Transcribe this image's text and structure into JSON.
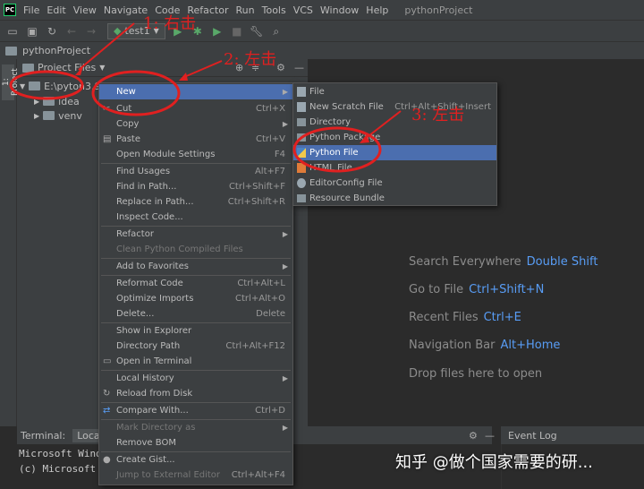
{
  "app": {
    "logo": "PC",
    "window_title": "pythonProject"
  },
  "menubar": [
    "File",
    "Edit",
    "View",
    "Navigate",
    "Code",
    "Refactor",
    "Run",
    "Tools",
    "VCS",
    "Window",
    "Help"
  ],
  "toolbar": {
    "run_config": "test1"
  },
  "breadcrumb": {
    "project": "pythonProject"
  },
  "left_stripe": {
    "label": "1: Project"
  },
  "project_panel": {
    "header": "Project Files",
    "tree": [
      {
        "label": "E:\\pyton3.9\\...Project",
        "type": "root"
      },
      {
        "label": "idea",
        "type": "folder"
      },
      {
        "label": "venv",
        "type": "folder"
      }
    ]
  },
  "context_menu": {
    "items": [
      {
        "label": "New",
        "submenu": true,
        "selected": true
      },
      {
        "label": "Cut",
        "shortcut": "Ctrl+X",
        "icon": "scissors-icon"
      },
      {
        "label": "Copy",
        "submenu": true
      },
      {
        "label": "Paste",
        "shortcut": "Ctrl+V",
        "icon": "clipboard-icon"
      },
      {
        "label": "Open Module Settings",
        "shortcut": "F4"
      },
      {
        "label": "Find Usages",
        "shortcut": "Alt+F7"
      },
      {
        "label": "Find in Path...",
        "shortcut": "Ctrl+Shift+F"
      },
      {
        "label": "Replace in Path...",
        "shortcut": "Ctrl+Shift+R"
      },
      {
        "label": "Inspect Code..."
      },
      {
        "label": "Refactor",
        "submenu": true
      },
      {
        "label": "Clean Python Compiled Files",
        "disabled": true
      },
      {
        "label": "Add to Favorites",
        "submenu": true
      },
      {
        "label": "Reformat Code",
        "shortcut": "Ctrl+Alt+L"
      },
      {
        "label": "Optimize Imports",
        "shortcut": "Ctrl+Alt+O"
      },
      {
        "label": "Delete...",
        "shortcut": "Delete"
      },
      {
        "label": "Show in Explorer"
      },
      {
        "label": "Directory Path",
        "shortcut": "Ctrl+Alt+F12"
      },
      {
        "label": "Open in Terminal",
        "icon": "terminal-icon"
      },
      {
        "label": "Local History",
        "submenu": true
      },
      {
        "label": "Reload from Disk",
        "icon": "reload-icon"
      },
      {
        "label": "Compare With...",
        "shortcut": "Ctrl+D",
        "icon": "compare-icon"
      },
      {
        "label": "Mark Directory as",
        "submenu": true,
        "disabled": true
      },
      {
        "label": "Remove BOM"
      },
      {
        "label": "Create Gist...",
        "icon": "github-icon"
      },
      {
        "label": "Jump to External Editor",
        "shortcut": "Ctrl+Alt+F4",
        "disabled": true
      }
    ]
  },
  "submenu": {
    "items": [
      {
        "label": "File"
      },
      {
        "label": "New Scratch File",
        "shortcut": "Ctrl+Alt+Shift+Insert"
      },
      {
        "label": "Directory"
      },
      {
        "label": "Python Package"
      },
      {
        "label": "Python File",
        "selected": true
      },
      {
        "label": "HTML File"
      },
      {
        "label": "EditorConfig File"
      },
      {
        "label": "Resource Bundle"
      }
    ]
  },
  "editor_hints": [
    {
      "label": "Search Everywhere",
      "key": "Double Shift"
    },
    {
      "label": "Go to File",
      "key": "Ctrl+Shift+N"
    },
    {
      "label": "Recent Files",
      "key": "Ctrl+E"
    },
    {
      "label": "Navigation Bar",
      "key": "Alt+Home"
    },
    {
      "label": "Drop files here to open",
      "key": ""
    }
  ],
  "terminal": {
    "title": "Terminal:",
    "tab": "Local",
    "lines": [
      "Microsoft Wind",
      "(c) Microsoft"
    ]
  },
  "event_log": {
    "title": "Event Log"
  },
  "annotations": [
    "1: 右击",
    "2: 左击",
    "3: 左击"
  ],
  "watermark": "知乎 @做个国家需要的研...",
  "colors": {
    "selection": "#4b6eaf",
    "annotation": "#e02020",
    "hint_key": "#589df6"
  }
}
